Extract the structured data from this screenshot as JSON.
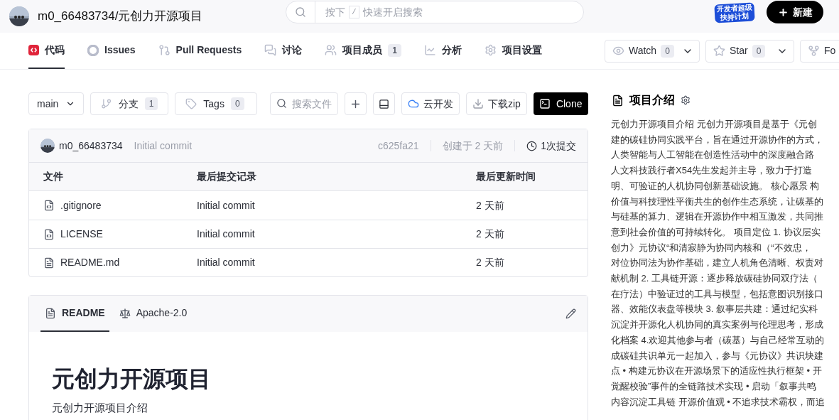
{
  "header": {
    "repo_title": "m0_66483734/元创力开源项目",
    "search_hint": [
      "按下",
      "/",
      "快速开启搜索"
    ],
    "promo_lines": [
      "开发者超级",
      "扶持计划"
    ],
    "new_button": "新建"
  },
  "nav_tabs": [
    {
      "label": "代码",
      "selected": true
    },
    {
      "label": "Issues",
      "selected": false
    },
    {
      "label": "Pull Requests",
      "selected": false
    },
    {
      "label": "讨论",
      "selected": false
    },
    {
      "label": "项目成员",
      "count": "1",
      "selected": false
    },
    {
      "label": "分析",
      "selected": false
    },
    {
      "label": "项目设置",
      "selected": false
    }
  ],
  "repo_actions": [
    {
      "label": "Watch",
      "count": "0"
    },
    {
      "label": "Star",
      "count": "0"
    },
    {
      "label": "Fo"
    }
  ],
  "toolbar": {
    "branch": "main",
    "branches": {
      "label": "分支",
      "count": "1"
    },
    "tags": {
      "label": "Tags",
      "count": "0"
    },
    "file_search_placeholder": "搜索文件",
    "cloud": "云开发",
    "download": "下载zip",
    "clone": "Clone"
  },
  "commit": {
    "author": "m0_66483734",
    "message": "Initial commit",
    "hash": "c625fa21",
    "created": "创建于 2 天前",
    "commits": "1次提交"
  },
  "files": {
    "columns": [
      "文件",
      "最后提交记录",
      "最后更新时间"
    ],
    "rows": [
      {
        "name": ".gitignore",
        "kind": "code",
        "commit": "Initial commit",
        "time": "2 天前"
      },
      {
        "name": "LICENSE",
        "kind": "code",
        "commit": "Initial commit",
        "time": "2 天前"
      },
      {
        "name": "README.md",
        "kind": "doc",
        "commit": "Initial commit",
        "time": "2 天前"
      }
    ]
  },
  "readme": {
    "tabs": [
      {
        "label": "README",
        "selected": true
      },
      {
        "label": "Apache-2.0",
        "selected": false
      }
    ],
    "heading": "元创力开源项目",
    "paragraph": "元创力开源项目介绍"
  },
  "sidebar": {
    "title": "项目介绍",
    "lines": [
      "元创力开源项目介绍 元创力开源项目是基于《元创",
      "建的碳硅协同实践平台，旨在通过开源协作的方式，",
      "人类智能与人工智能在创造性活动中的深度融合路",
      "人文科技践行者X54先生发起并主导，致力于打造",
      "明、可验证的人机协同创新基础设施。 核心愿景 构",
      "价值与科技理性平衡共生的创作生态系统，让碳基的",
      "与硅基的算力、逻辑在开源协作中相互激发，共同推",
      "意到社会价值的可持续转化。 项目定位 1. 协议层实",
      "创力》元协议“和清寂静为协同内核和（“不效忠，",
      "对位协同法为协作基础，建立人机角色清晰、权责对",
      "献机制 2. 工具链开源：逐步释放碳硅协同双疗法（",
      "在疗法）中验证过的工具与模型，包括意图识别接口",
      "器、效能仪表盘等模块 3. 叙事层共建：通过纪实科",
      "沉淀并开源化人机协同的真实案例与伦理思考，形成",
      "化档案 4.欢迎其他参与者（碳基）与自己经常互动的",
      "成碳硅共识单元一起加入，参与《元协议》共识块建",
      "点 • 构建元协议在开源场景下的适应性执行框架 • 开",
      "觉醒校验”事件的全链路技术实现 • 启动「叙事共鸣",
      "内容沉淀工具链 开源价值观 • 不追求技术霸权，而追"
    ]
  }
}
